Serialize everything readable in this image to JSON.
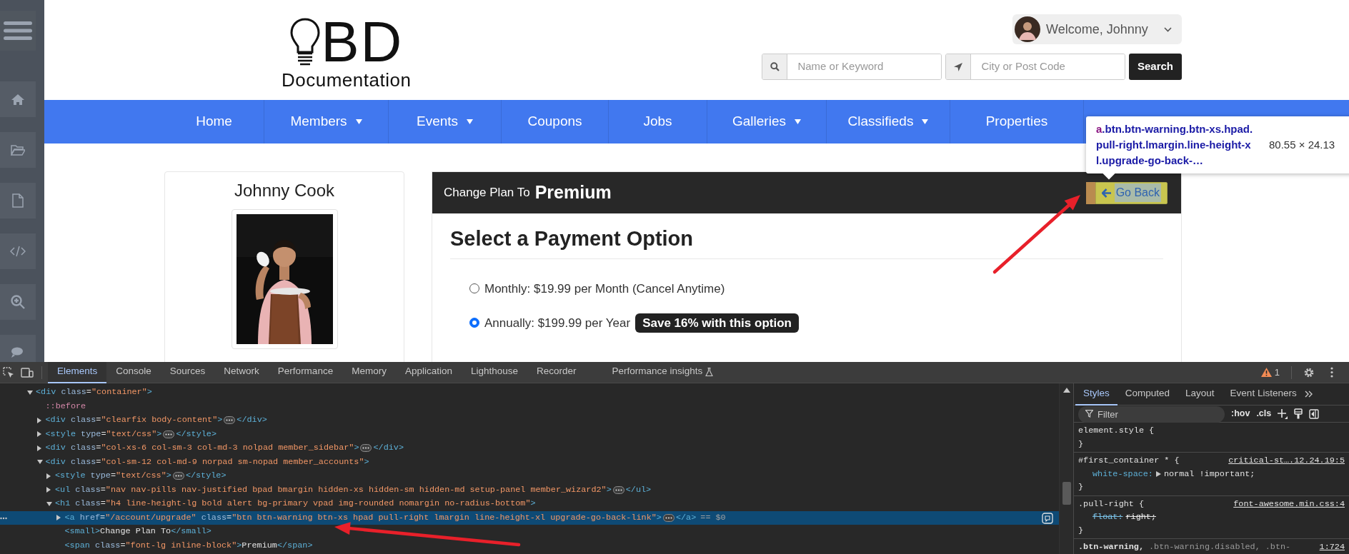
{
  "logo": {
    "mark": "BD",
    "tagline": "Documentation"
  },
  "account": {
    "greeting": "Welcome, Johnny"
  },
  "search": {
    "keyword_placeholder": "Name or Keyword",
    "location_placeholder": "City or Post Code",
    "button": "Search"
  },
  "nav": [
    {
      "label": "Home",
      "dropdown": false
    },
    {
      "label": "Members",
      "dropdown": true
    },
    {
      "label": "Events",
      "dropdown": true
    },
    {
      "label": "Coupons",
      "dropdown": false
    },
    {
      "label": "Jobs",
      "dropdown": false
    },
    {
      "label": "Galleries",
      "dropdown": true
    },
    {
      "label": "Classifieds",
      "dropdown": true
    },
    {
      "label": "Properties",
      "dropdown": false
    }
  ],
  "profile": {
    "name": "Johnny Cook"
  },
  "plan_panel": {
    "prefix": "Change Plan To",
    "plan": "Premium",
    "back_button": "Go Back",
    "title": "Select a Payment Option",
    "options": [
      {
        "label": "Monthly: $19.99 per Month (Cancel Anytime)",
        "selected": false
      },
      {
        "label": "Annually: $199.99 per Year",
        "selected": true,
        "badge": "Save 16% with this option"
      }
    ]
  },
  "inspect_tooltip": {
    "tag": "a",
    "selector": ".btn.btn-warning.btn-xs.hpad.pull-right.lmargin.line-height-xl.upgrade-go-back-…",
    "size": "80.55 × 24.13"
  },
  "devtools": {
    "tabs": [
      {
        "label": "Elements",
        "selected": true
      },
      {
        "label": "Console",
        "selected": false
      },
      {
        "label": "Sources",
        "selected": false
      },
      {
        "label": "Network",
        "selected": false
      },
      {
        "label": "Performance",
        "selected": false
      },
      {
        "label": "Memory",
        "selected": false
      },
      {
        "label": "Application",
        "selected": false
      },
      {
        "label": "Lighthouse",
        "selected": false
      },
      {
        "label": "Recorder",
        "selected": false
      },
      {
        "label": "Performance insights",
        "selected": false
      }
    ],
    "warnings": "1",
    "dom": [
      {
        "kind": "element",
        "code": "<div class=\"container\">",
        "expanded": true,
        "selected": false,
        "children": [
          {
            "kind": "pseudo",
            "code": "::before",
            "selected": false
          },
          {
            "kind": "element",
            "code": "<div class=\"clearfix body-content\">",
            "expanded": false,
            "close": "</div>",
            "selected": false
          },
          {
            "kind": "element",
            "code": "<style type=\"text/css\">",
            "expanded": false,
            "close": "</style>",
            "selected": false
          },
          {
            "kind": "element",
            "code": "<div class=\"col-xs-6 col-sm-3 col-md-3 nolpad member_sidebar\">",
            "expanded": false,
            "close": "</div>",
            "selected": false
          },
          {
            "kind": "element",
            "code": "<div class=\"col-sm-12 col-md-9 norpad sm-nopad member_accounts\">",
            "expanded": true,
            "selected": false,
            "children": [
              {
                "kind": "element",
                "code": "<style type=\"text/css\">",
                "expanded": false,
                "close": "</style>",
                "selected": false
              },
              {
                "kind": "element",
                "code": "<ul class=\"nav nav-pills nav-justified bpad bmargin hidden-xs hidden-sm hidden-md setup-panel member_wizard2\">",
                "expanded": false,
                "close": "</ul>",
                "selected": false
              },
              {
                "kind": "element",
                "code": "<h1 class=\"h4 line-height-lg bold alert bg-primary vpad img-rounded nomargin no-radius-bottom\">",
                "expanded": true,
                "selected": false,
                "children": [
                  {
                    "kind": "element",
                    "code": "<a href=\"/account/upgrade\" class=\"btn btn-warning btn-xs hpad pull-right lmargin line-height-xl upgrade-go-back-link\">",
                    "expanded": false,
                    "close": "</a>",
                    "ref": "== $0",
                    "selected": true
                  },
                  {
                    "kind": "element",
                    "code": "<small>Change Plan To</small>",
                    "selected": false
                  },
                  {
                    "kind": "element",
                    "code": "<span class=\"font-lg inline-block\">Premium</span>",
                    "selected": false
                  }
                ]
              }
            ]
          }
        ]
      }
    ],
    "side_tabs": [
      {
        "label": "Styles",
        "selected": true
      },
      {
        "label": "Computed",
        "selected": false
      },
      {
        "label": "Layout",
        "selected": false
      },
      {
        "label": "Event Listeners",
        "selected": false
      }
    ],
    "filter_placeholder": "Filter",
    "filter_toggles": [
      ":hov",
      ".cls"
    ],
    "rules": [
      {
        "selectors": [
          {
            "text": "element.style {",
            "matched": true
          }
        ],
        "close": "}"
      },
      {
        "selectors": [
          {
            "text": "#first_container * {",
            "matched": true
          }
        ],
        "source": "critical-st….12.24.19:5",
        "declarations": [
          {
            "property": "white-space:",
            "value": "normal !important;",
            "expandable": true,
            "overridden": false
          }
        ],
        "close": "}"
      },
      {
        "selectors": [
          {
            "text": ".pull-right {",
            "matched": true
          }
        ],
        "source": "font-awesome.min.css:4",
        "declarations": [
          {
            "property": "float:",
            "value": "right;",
            "expandable": false,
            "overridden": true
          }
        ],
        "close": "}"
      },
      {
        "selectors": [
          {
            "text": ".btn-warning,",
            "matched": true
          },
          {
            "text": ".btn-warning.disabled,",
            "matched": false
          },
          {
            "text": ".btn-",
            "matched": false
          }
        ],
        "source": "1:724"
      }
    ]
  }
}
